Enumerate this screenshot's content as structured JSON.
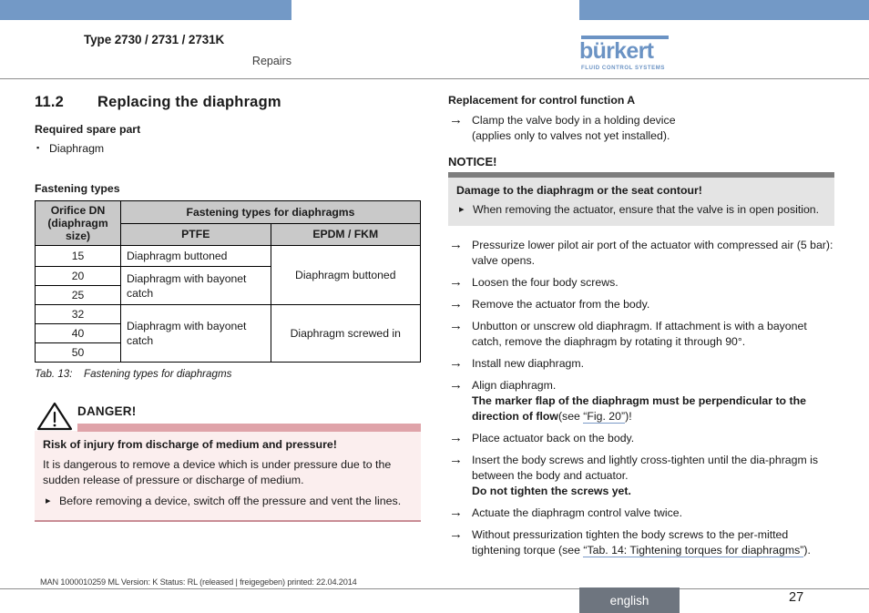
{
  "header": {
    "type_line": "Type 2730 / 2731 / 2731K",
    "subtitle": "Repairs",
    "logo_word": "bürkert",
    "logo_tagline": "FLUID CONTROL SYSTEMS",
    "accent_blue": "#7399c6"
  },
  "left": {
    "section_number": "11.2",
    "section_title": "Replacing the diaphragm",
    "required_label": "Required spare part",
    "required_items": [
      "Diaphragm"
    ],
    "fastening_label": "Fastening types",
    "table": {
      "header_dn": "Orifice DN (diaphragm size)",
      "header_group": "Fastening types for diaphragms",
      "header_ptfe": "PTFE",
      "header_epdm": "EPDM / FKM",
      "rows": [
        {
          "dn": "15"
        },
        {
          "dn": "20"
        },
        {
          "dn": "25"
        },
        {
          "dn": "32"
        },
        {
          "dn": "40"
        },
        {
          "dn": "50"
        }
      ],
      "ptfe_1": "Diaphragm buttoned",
      "ptfe_2": "Diaphragm with bayonet catch",
      "ptfe_3": "Diaphragm with bayonet catch",
      "epdm_1": "Diaphragm buttoned",
      "epdm_2": "Diaphragm screwed in"
    },
    "table_caption_id": "Tab. 13:",
    "table_caption_text": "Fastening types for diaphragms",
    "danger": {
      "word": "DANGER!",
      "title": "Risk of injury from discharge of medium and pressure!",
      "paragraph": "It is dangerous to remove a device which is under pressure due to the sudden release of pressure or discharge of medium.",
      "bullet": "Before removing a device, switch off the pressure and vent the lines.",
      "bar_color": "#dfa3a9",
      "bg_color": "#fbeeee"
    }
  },
  "right": {
    "heading": "Replacement for control function A",
    "step_clamp_1": "Clamp the valve body in a holding device",
    "step_clamp_2": "(applies only to valves not yet installed).",
    "notice": {
      "word": "NOTICE!",
      "title": "Damage to the diaphragm or the seat contour!",
      "bullet": "When removing the actuator, ensure that the valve is in open position.",
      "bar_color": "#7d7d7d",
      "bg_color": "#e4e4e4"
    },
    "step_pressurize": "Pressurize lower pilot air port of the actuator with compressed air (5 bar): valve opens.",
    "step_loosen": "Loosen the four body screws.",
    "step_remove": "Remove the actuator from the body.",
    "step_unbutton": "Unbutton or unscrew old diaphragm. If attachment is with a bayonet catch, remove the diaphragm by rotating it through 90°.",
    "step_install": "Install new diaphragm.",
    "step_align": "Align diaphragm.",
    "step_align_bold": "The marker flap of the diaphragm must be perpendicular to the direction of flow",
    "step_align_see": "(see ",
    "step_align_link": "“Fig. 20”",
    "step_align_end": ")!",
    "step_place": "Place actuator back on the body.",
    "step_insert": "Insert the body screws and lightly cross-tighten until the dia-phragm is between the body and actuator.",
    "step_insert_bold": "Do not tighten the screws yet.",
    "step_actuate": "Actuate the diaphragm control valve twice.",
    "step_torque_pre": "Without pressurization tighten the body screws to the per-mitted tightening torque (see ",
    "step_torque_link": "“Tab. 14: Tightening torques for diaphragms”",
    "step_torque_end": ")."
  },
  "footer": {
    "doc_info": "MAN 1000010259 ML  Version: K Status: RL (released | freigegeben)  printed: 22.04.2014",
    "language_badge": "english",
    "page_number": "27",
    "badge_color": "#6e757f"
  }
}
